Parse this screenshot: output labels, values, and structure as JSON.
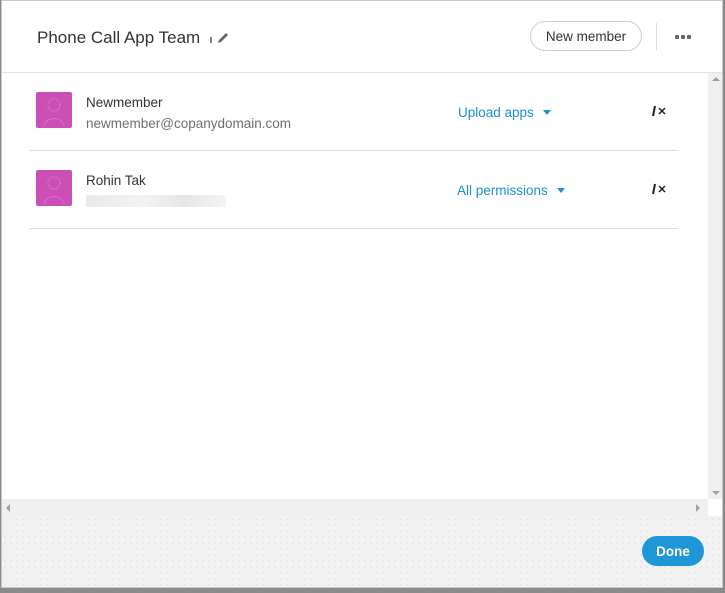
{
  "dialog": {
    "title": "Phone Call App Team",
    "new_member_label": "New member",
    "done_label": "Done"
  },
  "members": [
    {
      "name": "Newmember",
      "email": "newmember@copanydomain.com",
      "permission": "Upload apps",
      "avatar_color": "#cc4fb8"
    },
    {
      "name": "Rohin Tak",
      "email_redacted": true,
      "permission": "All permissions",
      "avatar_color": "#cc4fb8"
    }
  ],
  "icons": {
    "edit": "pencil-icon",
    "more": "more-dots-icon",
    "remove": "remove-icon"
  },
  "colors": {
    "accent": "#1a92cf",
    "done_button": "#1f96d6",
    "avatar": "#cc4fb8"
  }
}
